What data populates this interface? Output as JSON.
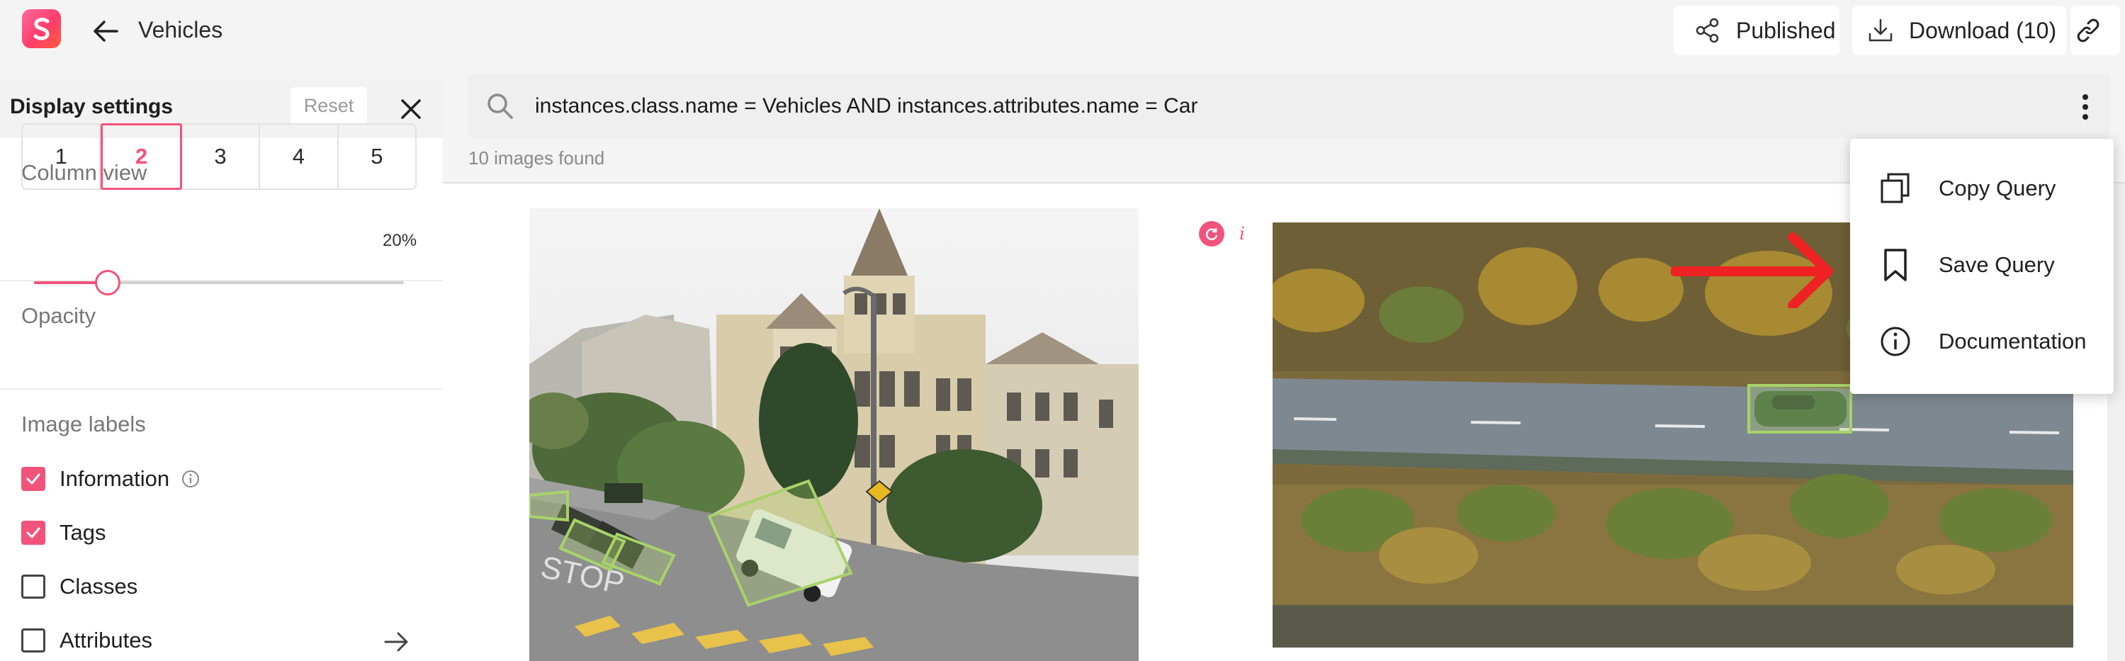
{
  "header": {
    "title": "Vehicles",
    "published_label": "Published",
    "download_label": "Download (10)"
  },
  "sidebar": {
    "title": "Display settings",
    "reset_label": "Reset",
    "column_view_label": "Column view",
    "column_options": [
      "1",
      "2",
      "3",
      "4",
      "5"
    ],
    "selected_column": "2",
    "opacity_label": "Opacity",
    "opacity_value": "20%",
    "opacity_fraction": 0.2,
    "image_labels_heading": "Image labels",
    "labels": [
      {
        "label": "Information",
        "checked": true
      },
      {
        "label": "Tags",
        "checked": true
      },
      {
        "label": "Classes",
        "checked": false
      },
      {
        "label": "Attributes",
        "checked": false
      }
    ]
  },
  "search": {
    "query": "instances.class.name = Vehicles AND instances.attributes.name = Car",
    "results_text": "10 images found"
  },
  "menu": {
    "items": [
      {
        "label": "Copy Query",
        "icon": "copy-icon"
      },
      {
        "label": "Save Query",
        "icon": "bookmark-icon"
      },
      {
        "label": "Documentation",
        "icon": "info-icon"
      }
    ]
  },
  "colors": {
    "accent": "#f2537a",
    "annotation_box": "#a8d26a",
    "pointer_arrow": "#ee2222"
  }
}
